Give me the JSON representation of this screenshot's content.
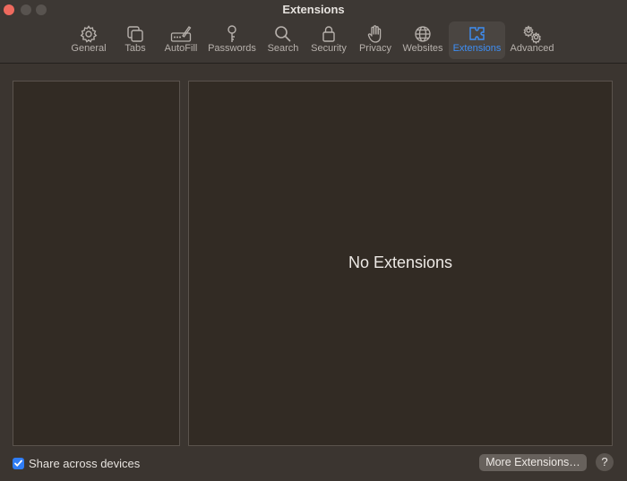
{
  "window": {
    "title": "Extensions"
  },
  "toolbar": {
    "tabs": [
      {
        "label": "General",
        "icon": "gear-icon"
      },
      {
        "label": "Tabs",
        "icon": "tabs-icon"
      },
      {
        "label": "AutoFill",
        "icon": "autofill-icon"
      },
      {
        "label": "Passwords",
        "icon": "key-icon"
      },
      {
        "label": "Search",
        "icon": "magnifier-icon"
      },
      {
        "label": "Security",
        "icon": "lock-icon"
      },
      {
        "label": "Privacy",
        "icon": "hand-icon"
      },
      {
        "label": "Websites",
        "icon": "globe-icon"
      },
      {
        "label": "Extensions",
        "icon": "puzzle-icon",
        "selected": true
      },
      {
        "label": "Advanced",
        "icon": "gears-icon"
      }
    ],
    "accent_color": "#3e8ef4"
  },
  "main": {
    "empty_message": "No Extensions"
  },
  "footer": {
    "share_label": "Share across devices",
    "share_checked": true,
    "more_button_label": "More Extensions…",
    "help_label": "?"
  }
}
